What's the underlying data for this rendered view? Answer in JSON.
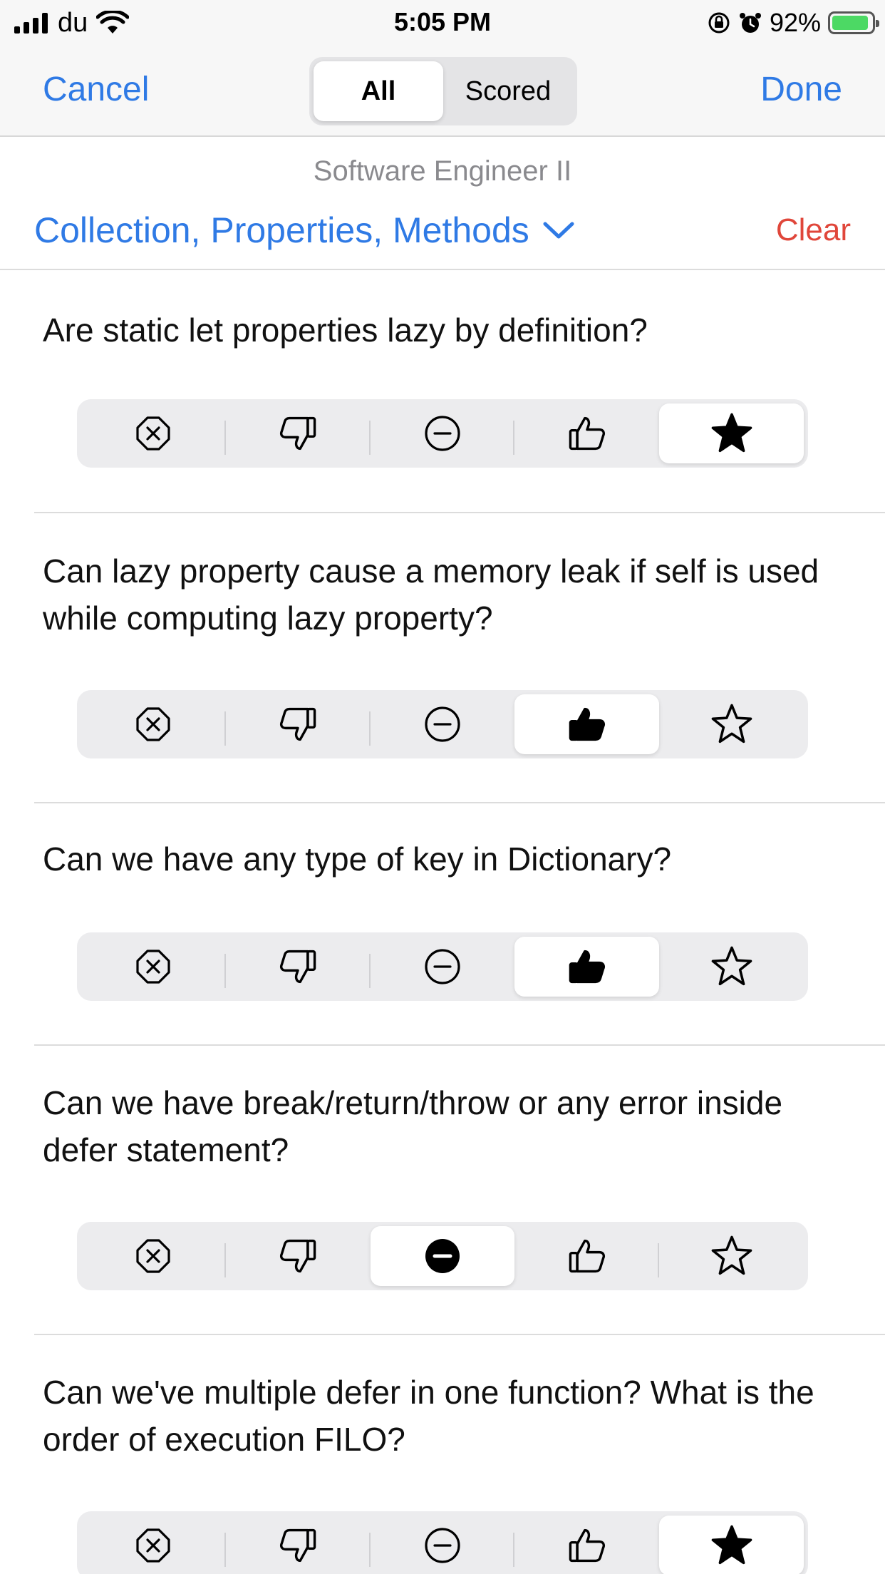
{
  "status_bar": {
    "carrier": "du",
    "time": "5:05 PM",
    "battery": "92%",
    "battery_level": 0.92
  },
  "nav": {
    "cancel": "Cancel",
    "done": "Done",
    "segments": [
      {
        "label": "All",
        "selected": true
      },
      {
        "label": "Scored",
        "selected": false
      }
    ]
  },
  "header": {
    "subtitle": "Software Engineer II",
    "filter": "Collection, Properties, Methods",
    "clear": "Clear"
  },
  "rating_options": [
    "reject",
    "thumbs-down",
    "neutral",
    "thumbs-up",
    "star"
  ],
  "questions": [
    {
      "text": "Are static let properties lazy by definition?",
      "selected": 4
    },
    {
      "text": "Can lazy property cause a memory leak if self is used while computing lazy property?",
      "selected": 3
    },
    {
      "text": "Can we have any type of key in Dictionary?",
      "selected": 3
    },
    {
      "text": "Can we have break/return/throw or any error inside defer statement?",
      "selected": 2
    },
    {
      "text": "Can we've multiple defer in one function? What is the order of execution FILO?",
      "selected": 4
    }
  ],
  "colors": {
    "accent": "#2f7ae5",
    "destructive": "#e0463a",
    "battery": "#4cd964"
  }
}
